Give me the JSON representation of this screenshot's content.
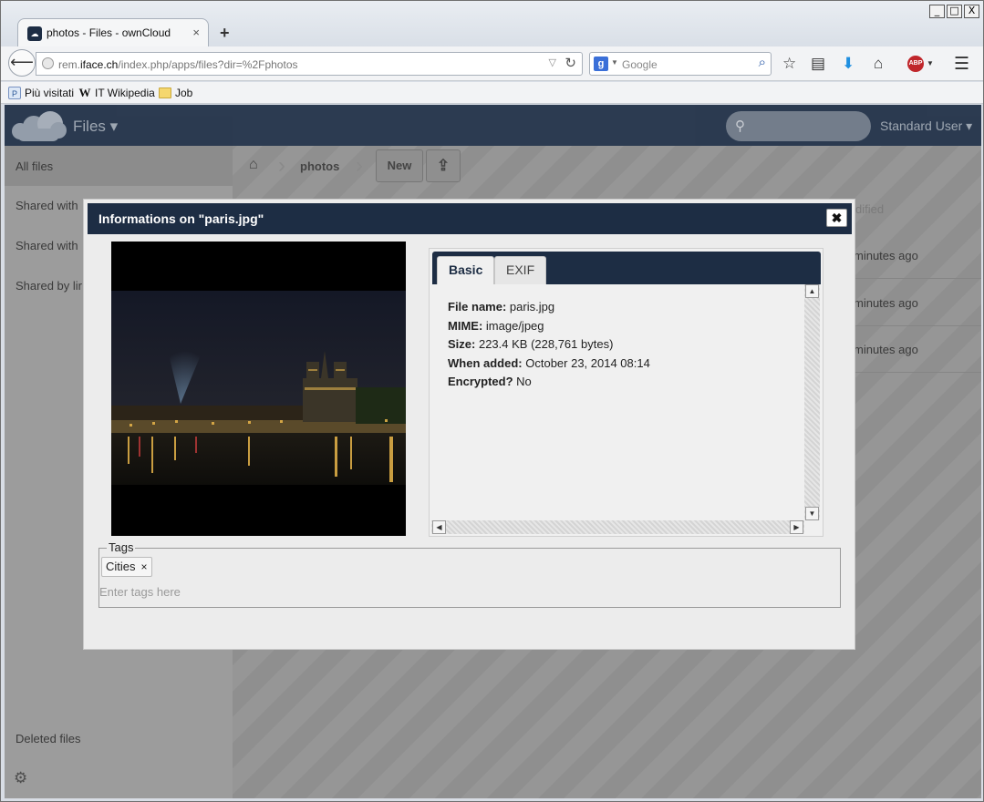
{
  "browser": {
    "tab_title": "photos - Files - ownCloud",
    "tab_close": "×",
    "new_tab": "+",
    "url_prefix": "rem.",
    "url_domain": "iface.ch",
    "url_rest": "/index.php/apps/files?dir=%2Fphotos",
    "search_placeholder": "Google",
    "window_buttons": [
      "_",
      "□",
      "X"
    ],
    "bookmarks": [
      {
        "label": "Più visitati",
        "icon": "piu-visitati-icon"
      },
      {
        "label": "IT Wikipedia",
        "icon": "wikipedia-icon"
      },
      {
        "label": "Job",
        "icon": "folder-icon"
      }
    ]
  },
  "header": {
    "app_name": "Files ▾",
    "user": "Standard User ▾"
  },
  "sidebar": {
    "items": [
      "All files",
      "Shared with",
      "Shared with",
      "Shared by lir"
    ],
    "deleted": "Deleted files"
  },
  "controls": {
    "breadcrumb": "photos",
    "new_label": "New"
  },
  "background_list": {
    "modified_header": "dified",
    "rows": [
      "minutes ago",
      "minutes ago",
      "minutes ago"
    ]
  },
  "modal": {
    "title": "Informations on \"paris.jpg\"",
    "close": "✖",
    "tabs": [
      "Basic",
      "EXIF"
    ],
    "info": [
      {
        "label": "File name:",
        "value": "paris.jpg"
      },
      {
        "label": "MIME:",
        "value": "image/jpeg"
      },
      {
        "label": "Size:",
        "value": "223.4 KB (228,761 bytes)"
      },
      {
        "label": "When added:",
        "value": "October 23, 2014 08:14"
      },
      {
        "label": "Encrypted?",
        "value": "No"
      }
    ],
    "tags_legend": "Tags",
    "tags": [
      "Cities"
    ],
    "tag_remove": "×",
    "tags_placeholder": "Enter tags here"
  }
}
